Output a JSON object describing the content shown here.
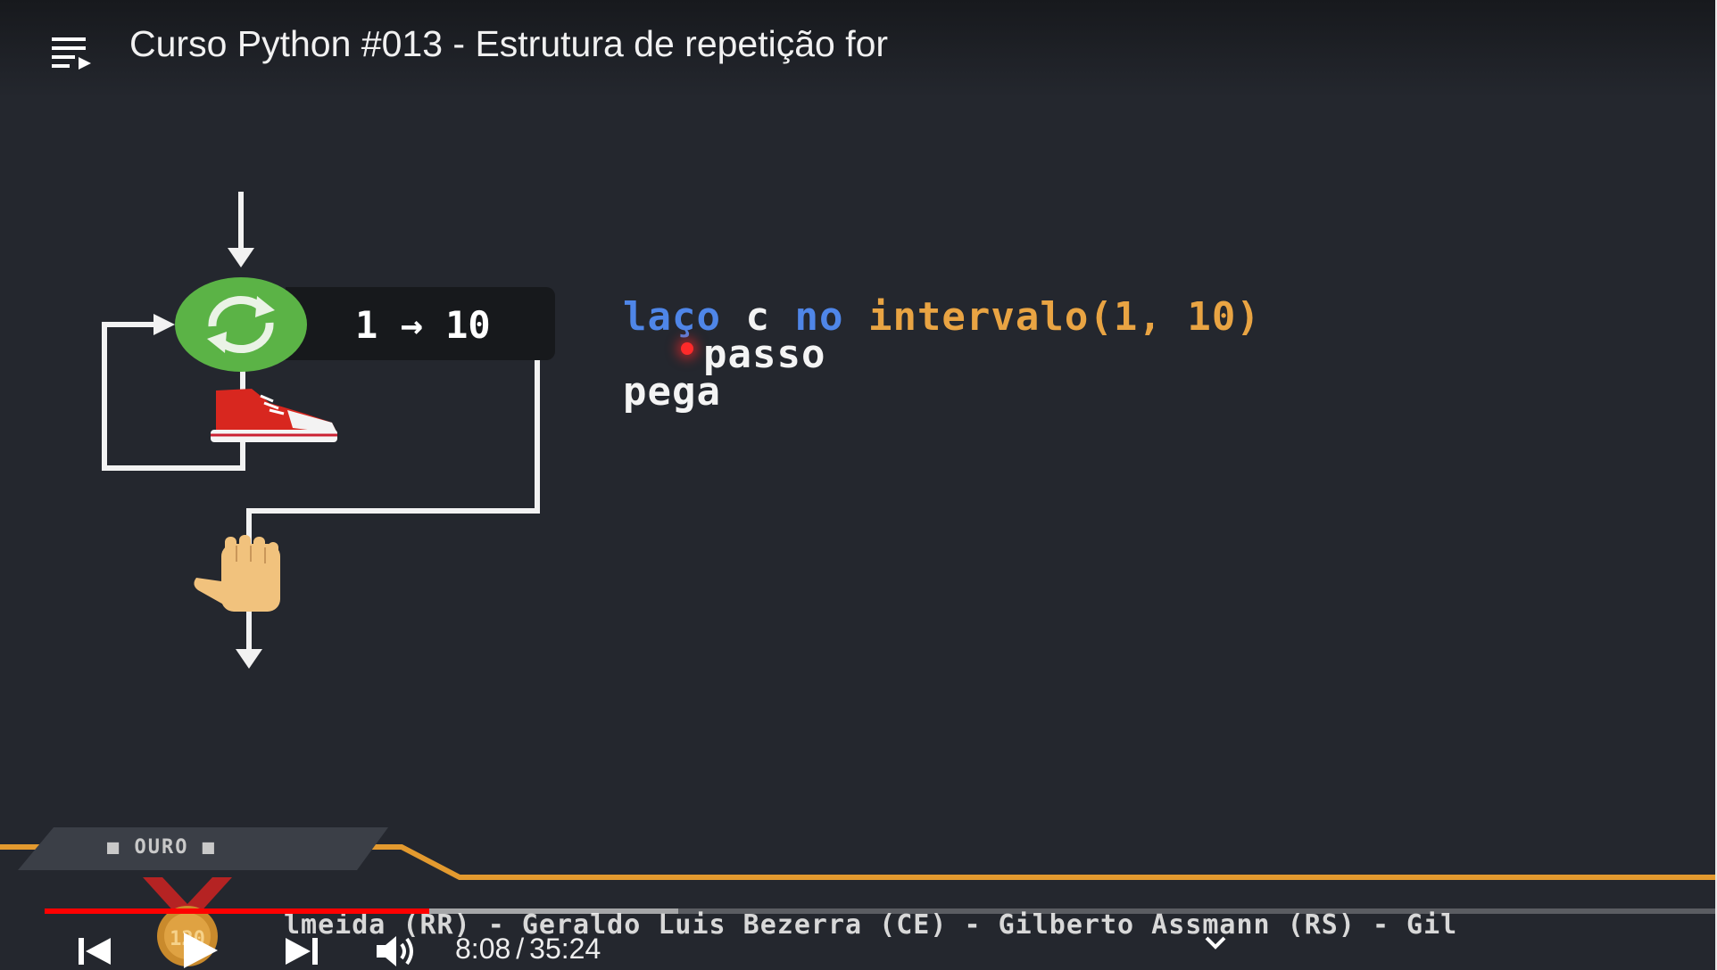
{
  "header": {
    "title": "Curso Python #013 - Estrutura de repetição for",
    "playlist_icon": "playlist-icon"
  },
  "diagram": {
    "range_label": "1 → 10",
    "loop_icon": "refresh-icon",
    "step_icon": "sneaker-icon",
    "stop_icon": "raised-hand-icon"
  },
  "code": {
    "line1": {
      "kw1": "laço",
      "var": "c",
      "kw2": "no",
      "func": "intervalo(1, 10)"
    },
    "line2": "passo",
    "line3": "pega"
  },
  "overlay": {
    "tier_label": "■ OURO ■",
    "medal_value": "120",
    "ticker": "lmeida (RR) - Geraldo Luis Bezerra (CE) - Gilberto Assmann (RS) - Gil"
  },
  "player": {
    "current_time": "8:08",
    "separator": "/",
    "duration": "35:24",
    "progress_fraction": 0.23,
    "colors": {
      "progress": "#ff0000",
      "accent_orange": "#e39a2f",
      "loop_green": "#5bb346",
      "code_blue": "#4f86e8",
      "code_orange": "#e9a443"
    }
  }
}
